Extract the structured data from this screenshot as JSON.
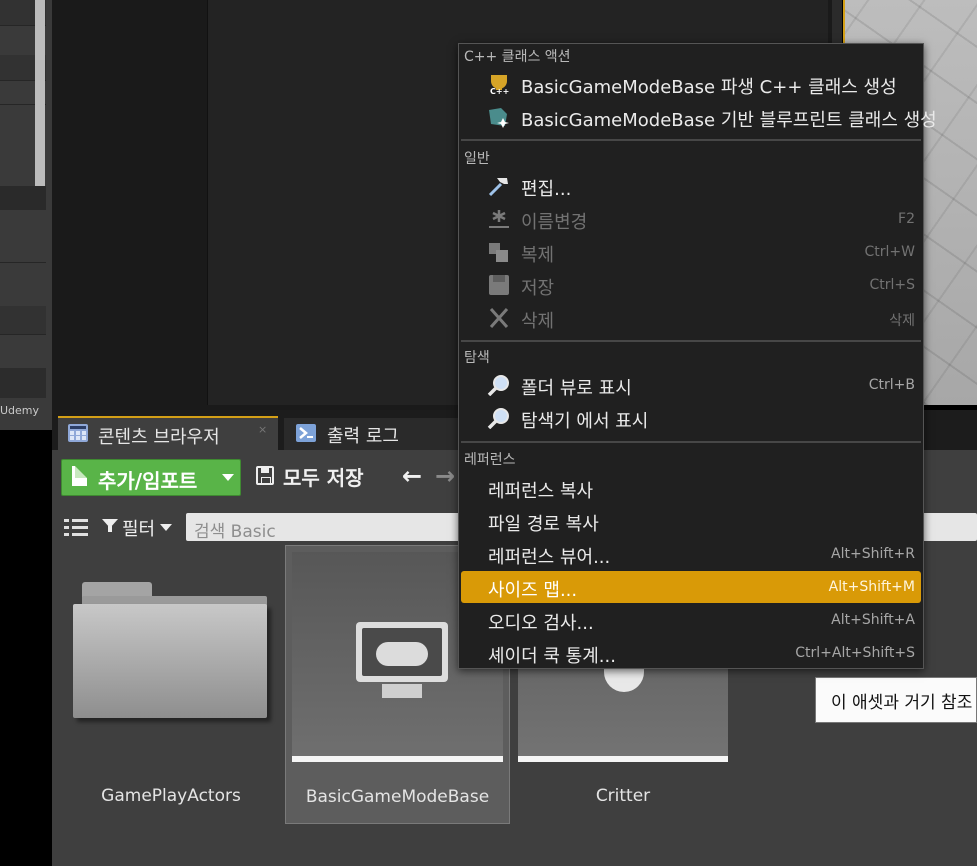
{
  "outliner": {
    "label": "Udemy"
  },
  "tabs": {
    "content_browser": "콘텐츠 브라우저",
    "close_glyph": "×",
    "output_log": "출력 로그"
  },
  "toolbar": {
    "add_import": "추가/임포트",
    "save_all": "모두 저장",
    "back_arrow": "←",
    "forward_arrow": "→"
  },
  "filter": {
    "label": "필터",
    "search_placeholder": "검색 Basic"
  },
  "assets": [
    {
      "name": "GamePlayActors"
    },
    {
      "name": "BasicGameModeBase"
    },
    {
      "name": "Critter"
    }
  ],
  "tooltip": "이 애셋과 거기 참조",
  "context_menu": {
    "sections": [
      {
        "header": "C++ 클래스 액션",
        "items": [
          {
            "label": "BasicGameModeBase 파생 C++ 클래스 생성",
            "shortcut": "",
            "icon": "cpp-class-icon",
            "enabled": true
          },
          {
            "label": "BasicGameModeBase 기반 블루프린트 클래스 생성",
            "shortcut": "",
            "icon": "blueprint-class-icon",
            "enabled": true
          }
        ]
      },
      {
        "header": "일반",
        "items": [
          {
            "label": "편집...",
            "shortcut": "",
            "icon": "hammer-icon",
            "enabled": true
          },
          {
            "label": "이름변경",
            "shortcut": "F2",
            "icon": "rename-icon",
            "enabled": false
          },
          {
            "label": "복제",
            "shortcut": "Ctrl+W",
            "icon": "duplicate-icon",
            "enabled": false
          },
          {
            "label": "저장",
            "shortcut": "Ctrl+S",
            "icon": "save-icon",
            "enabled": false
          },
          {
            "label": "삭제",
            "shortcut": "삭제",
            "icon": "delete-icon",
            "enabled": false
          }
        ]
      },
      {
        "header": "탐색",
        "items": [
          {
            "label": "폴더 뷰로 표시",
            "shortcut": "Ctrl+B",
            "icon": "magnifier-icon",
            "enabled": true
          },
          {
            "label": "탐색기 에서 표시",
            "shortcut": "",
            "icon": "magnifier-icon",
            "enabled": true
          }
        ]
      },
      {
        "header": "레퍼런스",
        "items": [
          {
            "label": "레퍼런스 복사",
            "shortcut": "",
            "enabled": true
          },
          {
            "label": "파일 경로 복사",
            "shortcut": "",
            "enabled": true
          },
          {
            "label": "레퍼런스 뷰어...",
            "shortcut": "Alt+Shift+R",
            "enabled": true
          },
          {
            "label": "사이즈 맵...",
            "shortcut": "Alt+Shift+M",
            "enabled": true,
            "highlighted": true
          },
          {
            "label": "오디오 검사...",
            "shortcut": "Alt+Shift+A",
            "enabled": true
          },
          {
            "label": "셰이더 쿡 통계...",
            "shortcut": "Ctrl+Alt+Shift+S",
            "enabled": true
          }
        ]
      }
    ]
  },
  "colors": {
    "add_button": "#59b448",
    "highlight": "#d99a07",
    "active_tab_accent": "#d4a017"
  }
}
